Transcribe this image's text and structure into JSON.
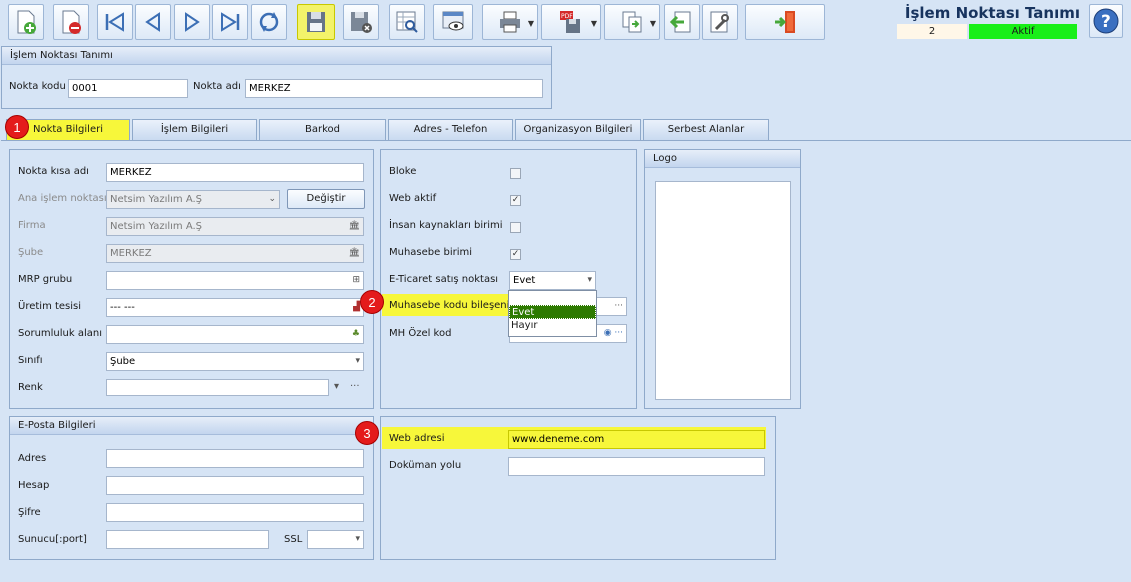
{
  "toolbar": {
    "buttons": [
      {
        "name": "new-record-button",
        "icon": "new-document-icon"
      },
      {
        "name": "delete-record-button",
        "icon": "delete-document-icon"
      },
      {
        "name": "first-record-button",
        "icon": "first-icon"
      },
      {
        "name": "previous-record-button",
        "icon": "previous-icon"
      },
      {
        "name": "next-record-button",
        "icon": "next-icon"
      },
      {
        "name": "last-record-button",
        "icon": "last-icon"
      },
      {
        "name": "refresh-button",
        "icon": "refresh-icon"
      },
      {
        "name": "save-button",
        "icon": "save-icon"
      },
      {
        "name": "save-close-button",
        "icon": "save-close-icon"
      },
      {
        "name": "search-list-button",
        "icon": "search-grid-icon"
      },
      {
        "name": "preview-button",
        "icon": "preview-icon"
      },
      {
        "name": "print-button",
        "icon": "printer-icon"
      },
      {
        "name": "export-pdf-button",
        "icon": "pdf-icon"
      },
      {
        "name": "copy-button",
        "icon": "copy-icon"
      },
      {
        "name": "back-button",
        "icon": "back-arrow-icon"
      },
      {
        "name": "tools-button",
        "icon": "tools-icon"
      },
      {
        "name": "exit-button",
        "icon": "exit-door-icon"
      }
    ]
  },
  "header": {
    "title": "İşlem Noktası Tanımı",
    "record_no": "2",
    "status": "Aktif",
    "status_color": "#19ef19",
    "help_icon": "help-icon"
  },
  "definition_panel": {
    "title": "İşlem Noktası Tanımı",
    "code_label": "Nokta kodu",
    "code_value": "0001",
    "name_label": "Nokta adı",
    "name_value": "MERKEZ"
  },
  "tabs": [
    {
      "label": "Nokta Bilgileri",
      "active": true
    },
    {
      "label": "İşlem Bilgileri",
      "active": false
    },
    {
      "label": "Barkod",
      "active": false
    },
    {
      "label": "Adres - Telefon",
      "active": false
    },
    {
      "label": "Organizasyon Bilgileri",
      "active": false
    },
    {
      "label": "Serbest Alanlar",
      "active": false
    }
  ],
  "badges": [
    "1",
    "2",
    "3"
  ],
  "point_info": {
    "short_name_label": "Nokta kısa adı",
    "short_name_value": "MERKEZ",
    "main_point_label": "Ana işlem noktası",
    "main_point_value": "Netsim Yazılım A.Ş",
    "change_button": "Değiştir",
    "company_label": "Firma",
    "company_value": "Netsim Yazılım A.Ş",
    "branch_label": "Şube",
    "branch_value": "MERKEZ",
    "mrp_label": "MRP grubu",
    "mrp_value": "",
    "production_label": "Üretim tesisi",
    "production_value": "--- ---",
    "responsibility_label": "Sorumluluk alanı",
    "responsibility_value": "",
    "class_label": "Sınıfı",
    "class_value": "Şube",
    "color_label": "Renk",
    "color_value": ""
  },
  "flags": {
    "bloke_label": "Bloke",
    "bloke_checked": false,
    "web_active_label": "Web aktif",
    "web_active_checked": true,
    "hr_label": "İnsan kaynakları birimi",
    "hr_checked": false,
    "accounting_label": "Muhasebe birimi",
    "accounting_checked": true,
    "ecommerce_label": "E-Ticaret satış noktası",
    "ecommerce_value": "Evet",
    "accounting_code_label": "Muhasebe kodu bileşeni",
    "mh_label": "MH Özel kod",
    "dropdown_options": [
      "",
      "Evet",
      "Hayır"
    ],
    "dropdown_selected": "Evet"
  },
  "logo_panel": {
    "title": "Logo"
  },
  "email_panel": {
    "title": "E-Posta Bilgileri",
    "address_label": "Adres",
    "account_label": "Hesap",
    "password_label": "Şifre",
    "server_label": "Sunucu[:port]",
    "ssl_label": "SSL"
  },
  "web_panel": {
    "web_label": "Web adresi",
    "web_value": "www.deneme.com",
    "doc_label": "Doküman yolu",
    "doc_value": ""
  },
  "colors": {
    "highlight": "#f7f73a",
    "badge": "#e41b1b",
    "dropdown_selected": "#2d7a00"
  }
}
